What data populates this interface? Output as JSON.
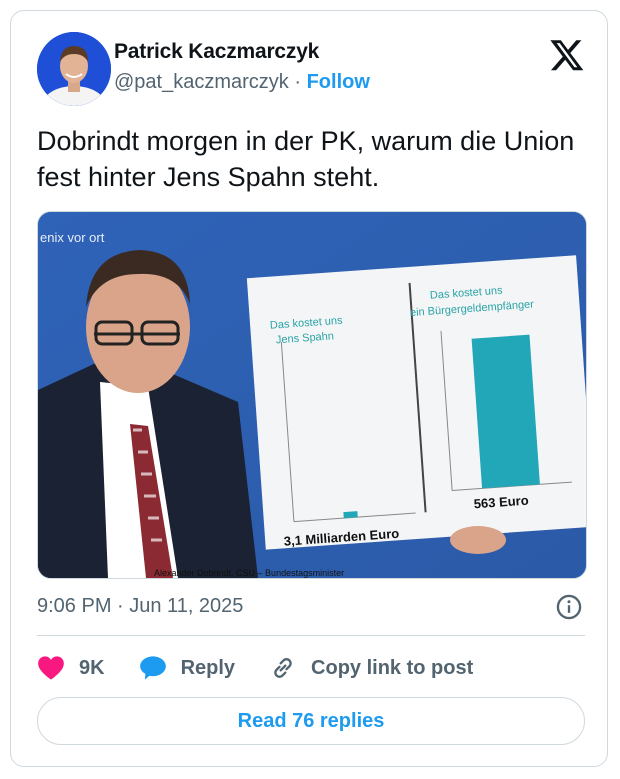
{
  "author": {
    "name": "Patrick Kaczmarczyk",
    "handle": "@pat_kaczmarczyk",
    "separator": "·",
    "follow_label": "Follow"
  },
  "tweet": {
    "text": "Dobrindt morgen in der PK, warum die Union fest hinter Jens Spahn steht."
  },
  "media": {
    "channel_logo": "enix vor ort",
    "caption_lower": "Alexander Dobrindt, CSU – Bundestagsminister",
    "board": {
      "left_panel": {
        "title_line1": "Das kostet uns",
        "title_line2": "Jens Spahn",
        "value_label": "3,1 Milliarden Euro"
      },
      "right_panel": {
        "title_line1": "Das kostet uns",
        "title_line2": "ein Bürgergeldempfänger",
        "value_label": "563 Euro"
      },
      "axis_ticks": [
        "600",
        "500",
        "400",
        "300",
        "0"
      ],
      "bar_color": "#22a7b8",
      "title_color": "#2aa3a6"
    }
  },
  "meta": {
    "timestamp": "9:06 PM · Jun 11, 2025"
  },
  "actions": {
    "likes": "9K",
    "reply": "Reply",
    "copy_link": "Copy link to post"
  },
  "read_replies": "Read 76 replies",
  "colors": {
    "accent": "#1d9bf0",
    "like": "#f91880",
    "muted": "#536471",
    "border": "#cfd9de"
  }
}
